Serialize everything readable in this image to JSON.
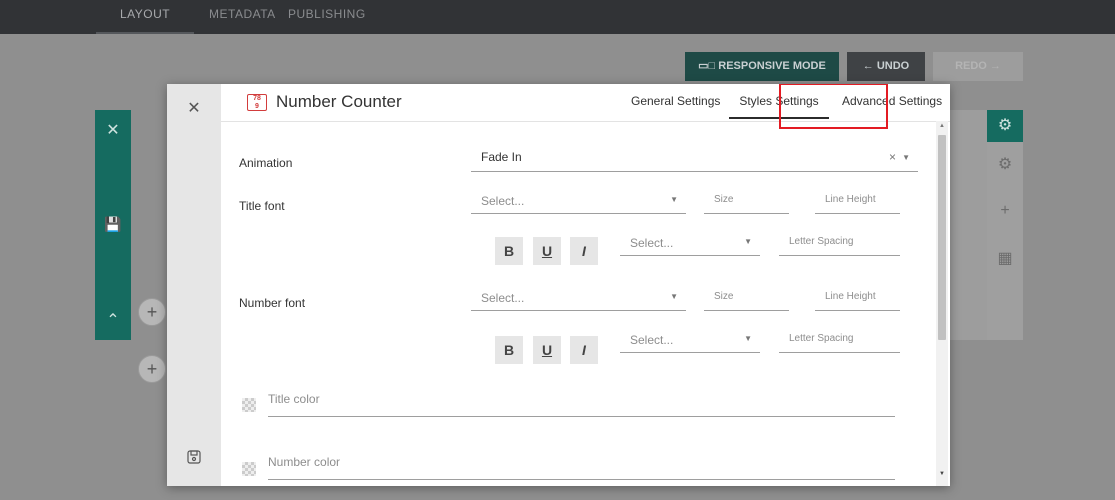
{
  "topbar": {
    "tabs": [
      {
        "label": "LAYOUT"
      },
      {
        "label": "METADATA"
      },
      {
        "label": "PUBLISHING"
      }
    ]
  },
  "toolbar": {
    "responsive_label": "RESPONSIVE MODE",
    "undo_label": "UNDO",
    "redo_label": "REDO"
  },
  "modal": {
    "title": "Number Counter",
    "tabs": [
      {
        "label": "General Settings"
      },
      {
        "label": "Styles Settings"
      },
      {
        "label": "Advanced Settings"
      }
    ],
    "animation": {
      "label": "Animation",
      "value": "Fade In"
    },
    "title_font": {
      "label": "Title font",
      "font_placeholder": "Select...",
      "size_placeholder": "Size",
      "line_height_placeholder": "Line Height",
      "weight_placeholder": "Select...",
      "letter_spacing_placeholder": "Letter Spacing"
    },
    "number_font": {
      "label": "Number font",
      "font_placeholder": "Select...",
      "size_placeholder": "Size",
      "line_height_placeholder": "Line Height",
      "weight_placeholder": "Select...",
      "letter_spacing_placeholder": "Letter Spacing"
    },
    "format_buttons": {
      "bold": "B",
      "underline": "U",
      "italic": "I"
    },
    "title_color_placeholder": "Title color",
    "number_color_placeholder": "Number color"
  },
  "colors": {
    "accent": "#156b60",
    "highlight": "#e31b23",
    "topbar": "#313336"
  }
}
